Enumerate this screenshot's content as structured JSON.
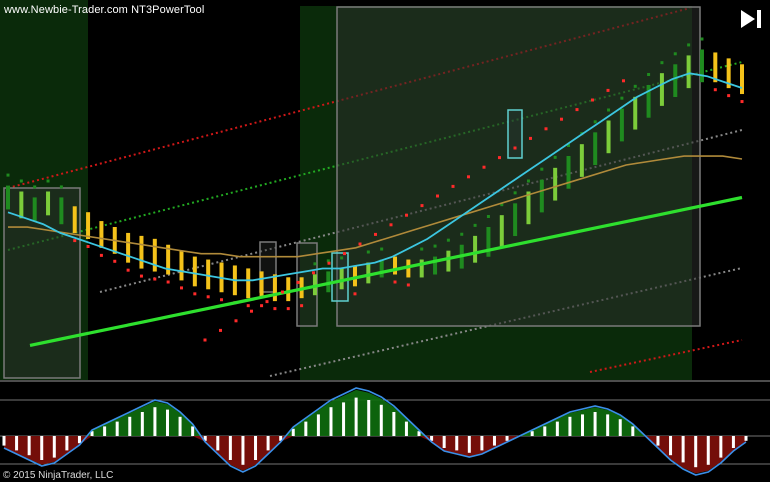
{
  "header": {
    "title": "www.Newbie-Trader.com NT3PowerTool"
  },
  "footer": {
    "copyright": "© 2015 NinjaTrader, LLC"
  },
  "controls": {
    "play_icon": "play-next-icon"
  },
  "colors": {
    "background": "#000000",
    "session_shade": "#0a2a0a",
    "zone_box": "#3a3a3a",
    "bar_bull_light": "#7ccd3a",
    "bar_bull_dark": "#1f8b1f",
    "bar_bear": "#f4c21a",
    "bar_bear_edge": "#ffd43a",
    "fast_ma": "#3cc6e0",
    "slow_ma": "#b08a3a",
    "long_ma": "#2ee02e",
    "band_upper": "#d01818",
    "band_mid": "#22aa22",
    "band_gray": "#888888",
    "trail_stop": "#ff2a2a",
    "osc_green": "#0e6e0e",
    "osc_red": "#7a0a0a",
    "osc_hist": "#ffffff",
    "osc_signal": "#3a8fe8"
  },
  "chart_data": {
    "type": "candlestick-with-indicators",
    "note_series": "Price panel with moving averages and trailing stop; lower oscillator panel with histogram and filled signal area.",
    "price_panel": {
      "bars": [
        {
          "i": 0,
          "o": 62,
          "c": 58,
          "dir": "up"
        },
        {
          "i": 1,
          "o": 60,
          "c": 55,
          "dir": "up"
        },
        {
          "i": 2,
          "o": 58,
          "c": 54,
          "dir": "up"
        },
        {
          "i": 3,
          "o": 60,
          "c": 56,
          "dir": "up"
        },
        {
          "i": 4,
          "o": 58,
          "c": 53,
          "dir": "up"
        },
        {
          "i": 5,
          "o": 55,
          "c": 50,
          "dir": "down"
        },
        {
          "i": 6,
          "o": 53,
          "c": 48,
          "dir": "down"
        },
        {
          "i": 7,
          "o": 50,
          "c": 45,
          "dir": "down"
        },
        {
          "i": 8,
          "o": 48,
          "c": 43,
          "dir": "down"
        },
        {
          "i": 9,
          "o": 46,
          "c": 40,
          "dir": "down"
        },
        {
          "i": 10,
          "o": 45,
          "c": 38,
          "dir": "down"
        },
        {
          "i": 11,
          "o": 44,
          "c": 37,
          "dir": "down"
        },
        {
          "i": 12,
          "o": 42,
          "c": 36,
          "dir": "down"
        },
        {
          "i": 13,
          "o": 40,
          "c": 34,
          "dir": "down"
        },
        {
          "i": 14,
          "o": 38,
          "c": 32,
          "dir": "down"
        },
        {
          "i": 15,
          "o": 37,
          "c": 31,
          "dir": "down"
        },
        {
          "i": 16,
          "o": 36,
          "c": 30,
          "dir": "down"
        },
        {
          "i": 17,
          "o": 35,
          "c": 29,
          "dir": "down"
        },
        {
          "i": 18,
          "o": 34,
          "c": 28,
          "dir": "down"
        },
        {
          "i": 19,
          "o": 33,
          "c": 28,
          "dir": "down"
        },
        {
          "i": 20,
          "o": 32,
          "c": 27,
          "dir": "down"
        },
        {
          "i": 21,
          "o": 31,
          "c": 27,
          "dir": "down"
        },
        {
          "i": 22,
          "o": 31,
          "c": 28,
          "dir": "down"
        },
        {
          "i": 23,
          "o": 32,
          "c": 29,
          "dir": "up"
        },
        {
          "i": 24,
          "o": 33,
          "c": 30,
          "dir": "up"
        },
        {
          "i": 25,
          "o": 34,
          "c": 31,
          "dir": "up"
        },
        {
          "i": 26,
          "o": 35,
          "c": 32,
          "dir": "down"
        },
        {
          "i": 27,
          "o": 36,
          "c": 33,
          "dir": "up"
        },
        {
          "i": 28,
          "o": 37,
          "c": 35,
          "dir": "up"
        },
        {
          "i": 29,
          "o": 38,
          "c": 36,
          "dir": "down"
        },
        {
          "i": 30,
          "o": 37,
          "c": 35,
          "dir": "down"
        },
        {
          "i": 31,
          "o": 37,
          "c": 35,
          "dir": "up"
        },
        {
          "i": 32,
          "o": 38,
          "c": 36,
          "dir": "up"
        },
        {
          "i": 33,
          "o": 40,
          "c": 37,
          "dir": "up"
        },
        {
          "i": 34,
          "o": 42,
          "c": 38,
          "dir": "up"
        },
        {
          "i": 35,
          "o": 45,
          "c": 40,
          "dir": "up"
        },
        {
          "i": 36,
          "o": 48,
          "c": 42,
          "dir": "up"
        },
        {
          "i": 37,
          "o": 52,
          "c": 45,
          "dir": "up"
        },
        {
          "i": 38,
          "o": 56,
          "c": 49,
          "dir": "up"
        },
        {
          "i": 39,
          "o": 60,
          "c": 53,
          "dir": "up"
        },
        {
          "i": 40,
          "o": 64,
          "c": 57,
          "dir": "up"
        },
        {
          "i": 41,
          "o": 68,
          "c": 61,
          "dir": "up"
        },
        {
          "i": 42,
          "o": 72,
          "c": 65,
          "dir": "up"
        },
        {
          "i": 43,
          "o": 76,
          "c": 69,
          "dir": "up"
        },
        {
          "i": 44,
          "o": 80,
          "c": 73,
          "dir": "up"
        },
        {
          "i": 45,
          "o": 84,
          "c": 77,
          "dir": "up"
        },
        {
          "i": 46,
          "o": 88,
          "c": 81,
          "dir": "up"
        },
        {
          "i": 47,
          "o": 92,
          "c": 85,
          "dir": "up"
        },
        {
          "i": 48,
          "o": 96,
          "c": 89,
          "dir": "up"
        },
        {
          "i": 49,
          "o": 100,
          "c": 93,
          "dir": "up"
        },
        {
          "i": 50,
          "o": 103,
          "c": 96,
          "dir": "up"
        },
        {
          "i": 51,
          "o": 106,
          "c": 99,
          "dir": "up"
        },
        {
          "i": 52,
          "o": 108,
          "c": 101,
          "dir": "up"
        },
        {
          "i": 53,
          "o": 107,
          "c": 101,
          "dir": "down"
        },
        {
          "i": 54,
          "o": 105,
          "c": 99,
          "dir": "down"
        },
        {
          "i": 55,
          "o": 103,
          "c": 97,
          "dir": "down"
        }
      ],
      "ma_fast": [
        55,
        53,
        51,
        48,
        46,
        44,
        42,
        40,
        38,
        36,
        35,
        34,
        33,
        32,
        32,
        33,
        34,
        35,
        36,
        36,
        37,
        38,
        40,
        43,
        46,
        50,
        54,
        58,
        62,
        66,
        70,
        74,
        78,
        82,
        86,
        90,
        94,
        97,
        100,
        102,
        101,
        99,
        97
      ],
      "ma_slow": [
        50,
        50,
        49,
        48,
        47,
        46,
        45,
        44,
        43,
        42,
        41,
        41,
        40,
        40,
        40,
        40,
        41,
        42,
        43,
        45,
        47,
        49,
        51,
        53,
        55,
        57,
        59,
        61,
        63,
        65,
        67,
        69,
        71,
        72,
        73,
        74,
        74,
        74,
        73
      ],
      "ma_long": [
        10,
        12,
        14,
        16,
        18,
        20,
        22,
        24,
        26,
        28,
        30,
        32,
        34,
        36,
        38,
        40,
        42,
        44,
        46,
        48,
        50,
        52,
        54,
        56,
        58,
        60
      ],
      "bands": {
        "upper": "rising dotted red",
        "mid": "rising dotted green",
        "lower": "rising dotted gray"
      }
    },
    "oscillator_panel": {
      "histogram": [
        -4,
        -6,
        -8,
        -10,
        -9,
        -6,
        -3,
        2,
        4,
        6,
        8,
        10,
        12,
        11,
        8,
        4,
        -2,
        -6,
        -10,
        -12,
        -10,
        -6,
        -2,
        3,
        6,
        9,
        12,
        14,
        16,
        15,
        13,
        10,
        6,
        2,
        -2,
        -5,
        -6,
        -7,
        -6,
        -4,
        -2,
        0,
        2,
        4,
        6,
        8,
        9,
        10,
        9,
        7,
        4,
        0,
        -4,
        -8,
        -11,
        -13,
        -12,
        -9,
        -5,
        -2
      ],
      "zero_line": 0
    }
  }
}
